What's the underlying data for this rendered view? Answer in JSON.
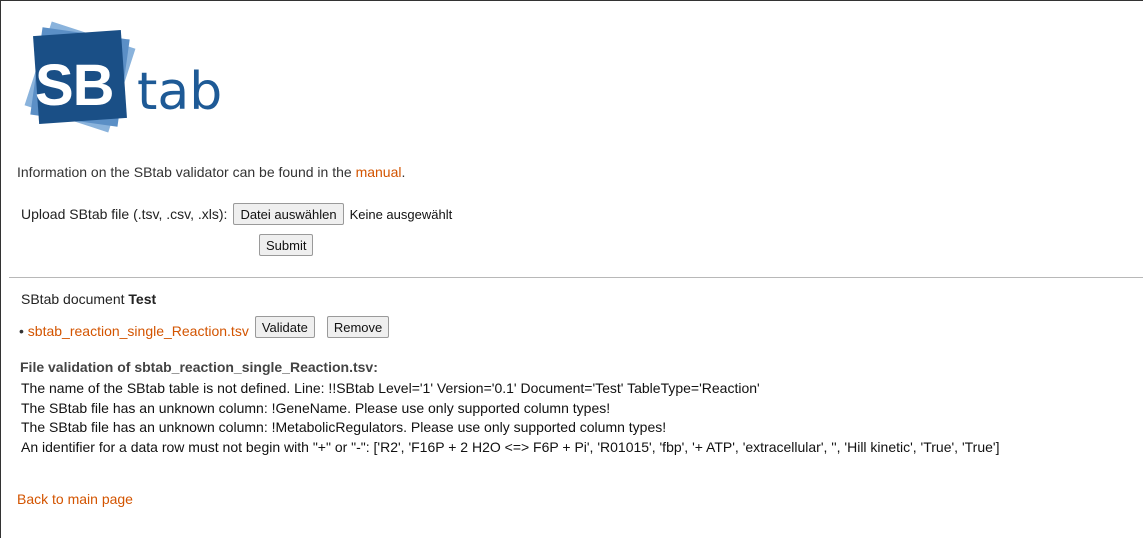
{
  "logo": {
    "sb": "SB",
    "tab": "tab",
    "colors": {
      "dark": "#1a4f86",
      "mid": "#2f6aa8",
      "light": "#6f9fd1",
      "text": "#1e5a96"
    }
  },
  "info": {
    "prefix": "Information on the SBtab validator can be found in the ",
    "link": "manual",
    "suffix": "."
  },
  "upload": {
    "label": "Upload SBtab file (.tsv, .csv, .xls):",
    "choose_button": "Datei auswählen",
    "no_file": "Keine ausgewählt",
    "submit": "Submit"
  },
  "document": {
    "prefix": "SBtab document ",
    "name": "Test"
  },
  "file": {
    "bullet": "•",
    "name": "sbtab_reaction_single_Reaction.tsv",
    "validate": "Validate",
    "remove": "Remove"
  },
  "validation": {
    "heading": "File validation of sbtab_reaction_single_Reaction.tsv:",
    "messages": [
      "The name of the SBtab table is not defined. Line: !!SBtab Level='1' Version='0.1' Document='Test' TableType='Reaction'",
      "The SBtab file has an unknown column: !GeneName. Please use only supported column types!",
      "The SBtab file has an unknown column: !MetabolicRegulators. Please use only supported column types!",
      "An identifier for a data row must not begin with \"+\" or \"-\": ['R2', 'F16P + 2 H2O <=> F6P + Pi', 'R01015', 'fbp', '+ ATP', 'extracellular', '', 'Hill kinetic', 'True', 'True']"
    ]
  },
  "back_link": "Back to main page",
  "colors": {
    "link": "#d35400",
    "divider": "#b8b8b8"
  }
}
